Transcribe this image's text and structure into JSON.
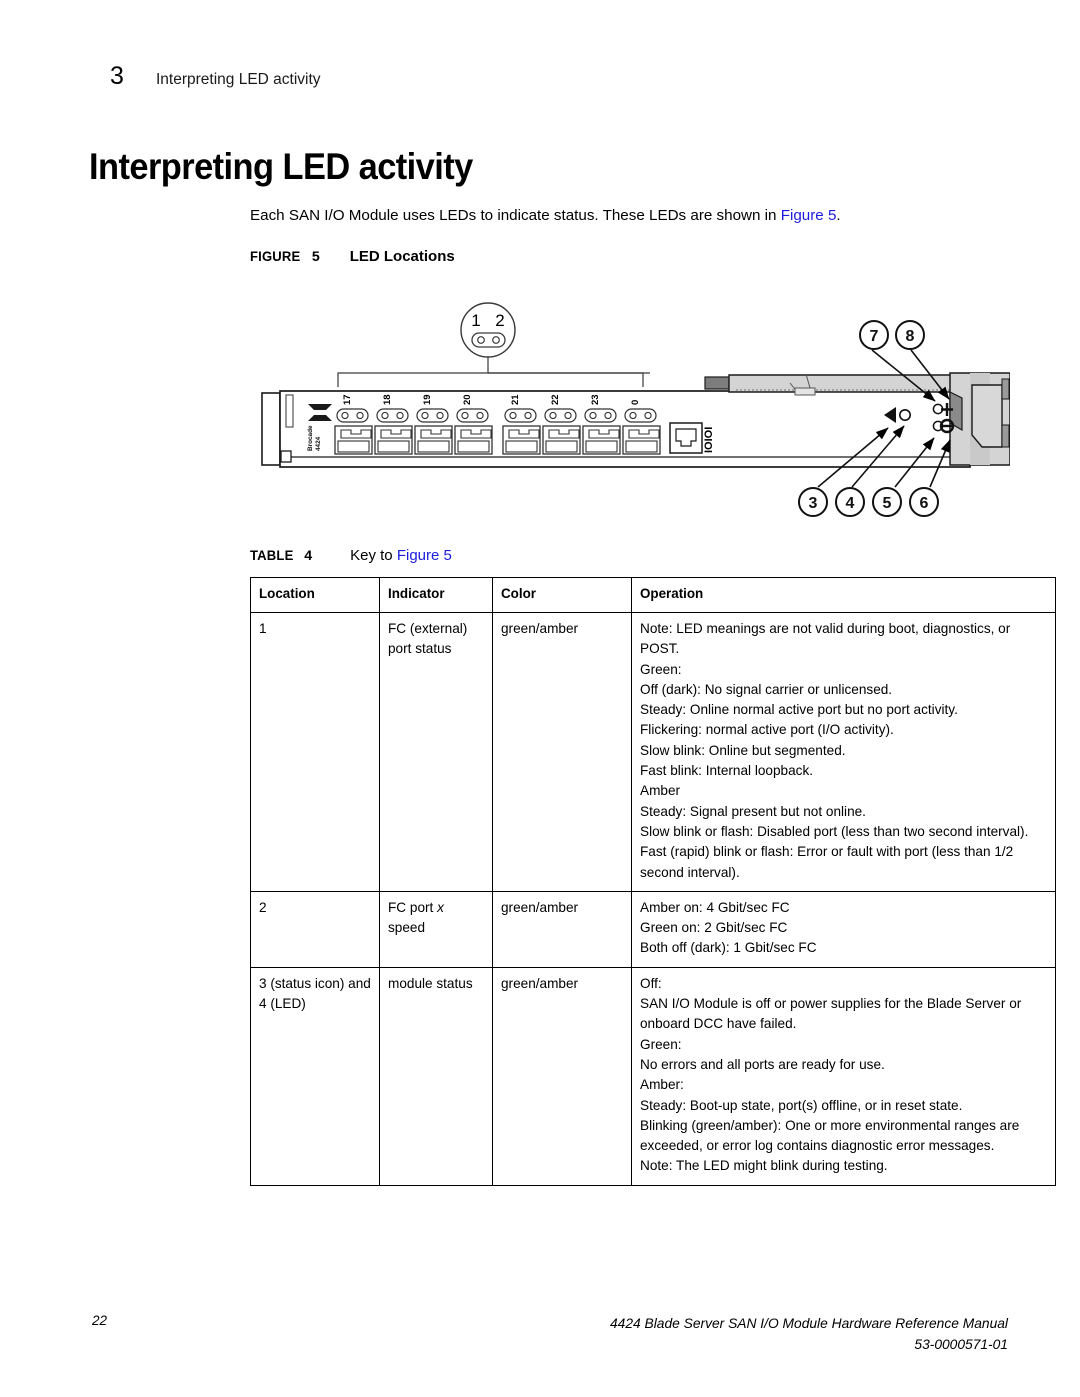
{
  "running_header": {
    "chapter_number": "3",
    "chapter_title": "Interpreting LED activity"
  },
  "heading": "Interpreting LED activity",
  "intro": {
    "before_link": "Each SAN I/O Module uses LEDs to indicate status. These LEDs are shown in ",
    "link": "Figure 5",
    "after_link": "."
  },
  "figure": {
    "label": "FIGURE",
    "number": "5",
    "title": "LED Locations",
    "brand": "Brocade",
    "model": "4424",
    "serial_port_label": "IOIOI",
    "port_labels": [
      "17",
      "18",
      "19",
      "20",
      "21",
      "22",
      "23",
      "0"
    ],
    "callouts": [
      "1",
      "2",
      "3",
      "4",
      "5",
      "6",
      "7",
      "8"
    ]
  },
  "table": {
    "label": "TABLE",
    "number": "4",
    "title_before_link": "Key to ",
    "title_link": "Figure 5",
    "headers": [
      "Location",
      "Indicator",
      "Color",
      "Operation"
    ],
    "rows": [
      {
        "location": "1",
        "indicator": "FC (external) port status",
        "color": "green/amber",
        "operation": [
          "Note: LED meanings are not valid during boot, diagnostics, or POST.",
          "Green:",
          "Off (dark): No signal carrier or unlicensed.",
          "Steady: Online normal active port but no port activity.",
          "Flickering: normal active port (I/O activity).",
          "Slow blink: Online but segmented.",
          "Fast blink: Internal loopback.",
          "Amber",
          "Steady: Signal present but not online.",
          "Slow blink or flash: Disabled port (less than two second interval).",
          "Fast (rapid) blink or flash: Error or fault with port (less than 1/2 second interval)."
        ]
      },
      {
        "location": "2",
        "indicator_prefix": "FC port ",
        "indicator_italic": "x",
        "indicator_suffix": " speed",
        "color": "green/amber",
        "operation": [
          "Amber on: 4 Gbit/sec FC",
          "Green on: 2 Gbit/sec FC",
          "Both off (dark): 1 Gbit/sec FC"
        ]
      },
      {
        "location": "3 (status icon) and 4 (LED)",
        "indicator": "module status",
        "color": "green/amber",
        "operation": [
          "Off:",
          "SAN I/O Module is off or power supplies for the Blade Server or onboard DCC have failed.",
          "Green:",
          "No errors and all ports are ready for use.",
          "Amber:",
          "Steady: Boot-up state, port(s) offline, or in reset state.",
          "Blinking (green/amber): One or more environmental ranges are exceeded, or error log contains diagnostic error messages.",
          "Note: The LED might blink during testing."
        ]
      }
    ]
  },
  "footer": {
    "page_number": "22",
    "manual_title": "4424 Blade Server SAN I/O Module Hardware Reference Manual",
    "doc_number": "53-0000571-01"
  },
  "colors": {
    "link": "#1c1cdd",
    "chassis_fill": "#d4d4d4",
    "chassis_stroke": "#1a1a1a"
  }
}
